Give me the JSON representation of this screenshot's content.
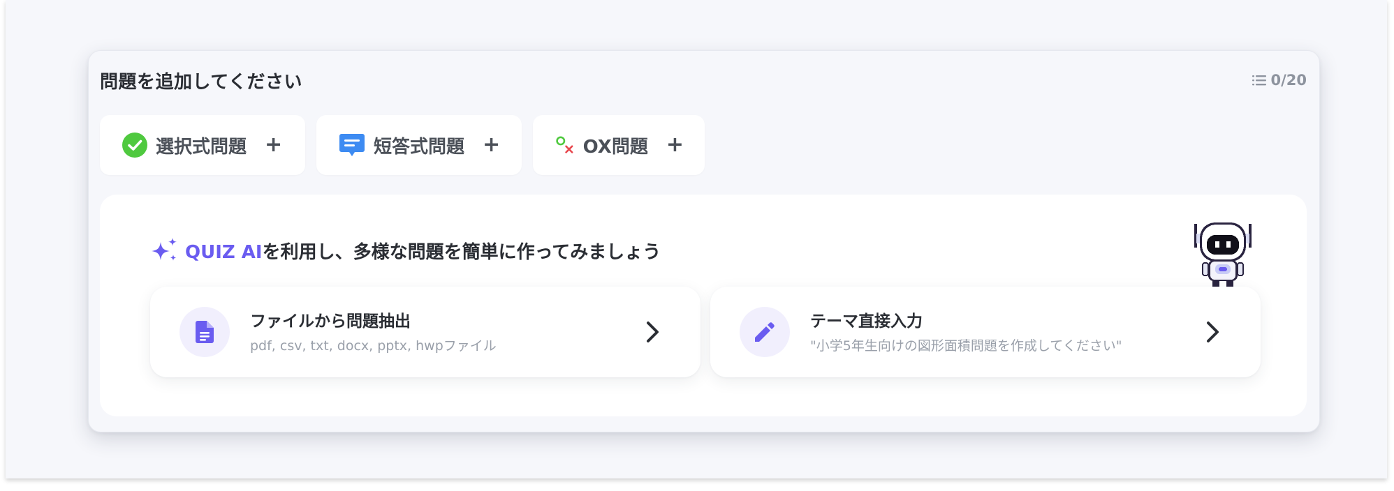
{
  "header": {
    "title": "問題を追加してください",
    "count": "0/20",
    "list_icon": "list-icon"
  },
  "add_buttons": [
    {
      "label": "選択式問題",
      "icon": "check-circle-icon",
      "icon_color": "#4fc93f"
    },
    {
      "label": "短答式問題",
      "icon": "chat-bubble-icon",
      "icon_color": "#3d8bf2"
    },
    {
      "label": "OX問題",
      "icon": "ox-icon",
      "icon_color": "#e8474d"
    }
  ],
  "add_plus": "+",
  "ai": {
    "brand": "QUIZ AI",
    "headline_rest": "を利用し、多様な問題を簡単に作ってみましょう",
    "sparkle_icon": "sparkle-icon",
    "mascot": "robot-mascot",
    "options": [
      {
        "title": "ファイルから問題抽出",
        "subtitle": "pdf, csv, txt, docx, pptx, hwpファイル",
        "icon": "document-icon"
      },
      {
        "title": "テーマ直接入力",
        "subtitle": "\"小学5年生向けの図形面積問題を作成してください\"",
        "icon": "pencil-icon"
      }
    ]
  },
  "colors": {
    "accent": "#6a5cf0",
    "background": "#f6f7fb",
    "card": "#ffffff",
    "text": "#2a2d33",
    "muted": "#9aa0aa"
  }
}
